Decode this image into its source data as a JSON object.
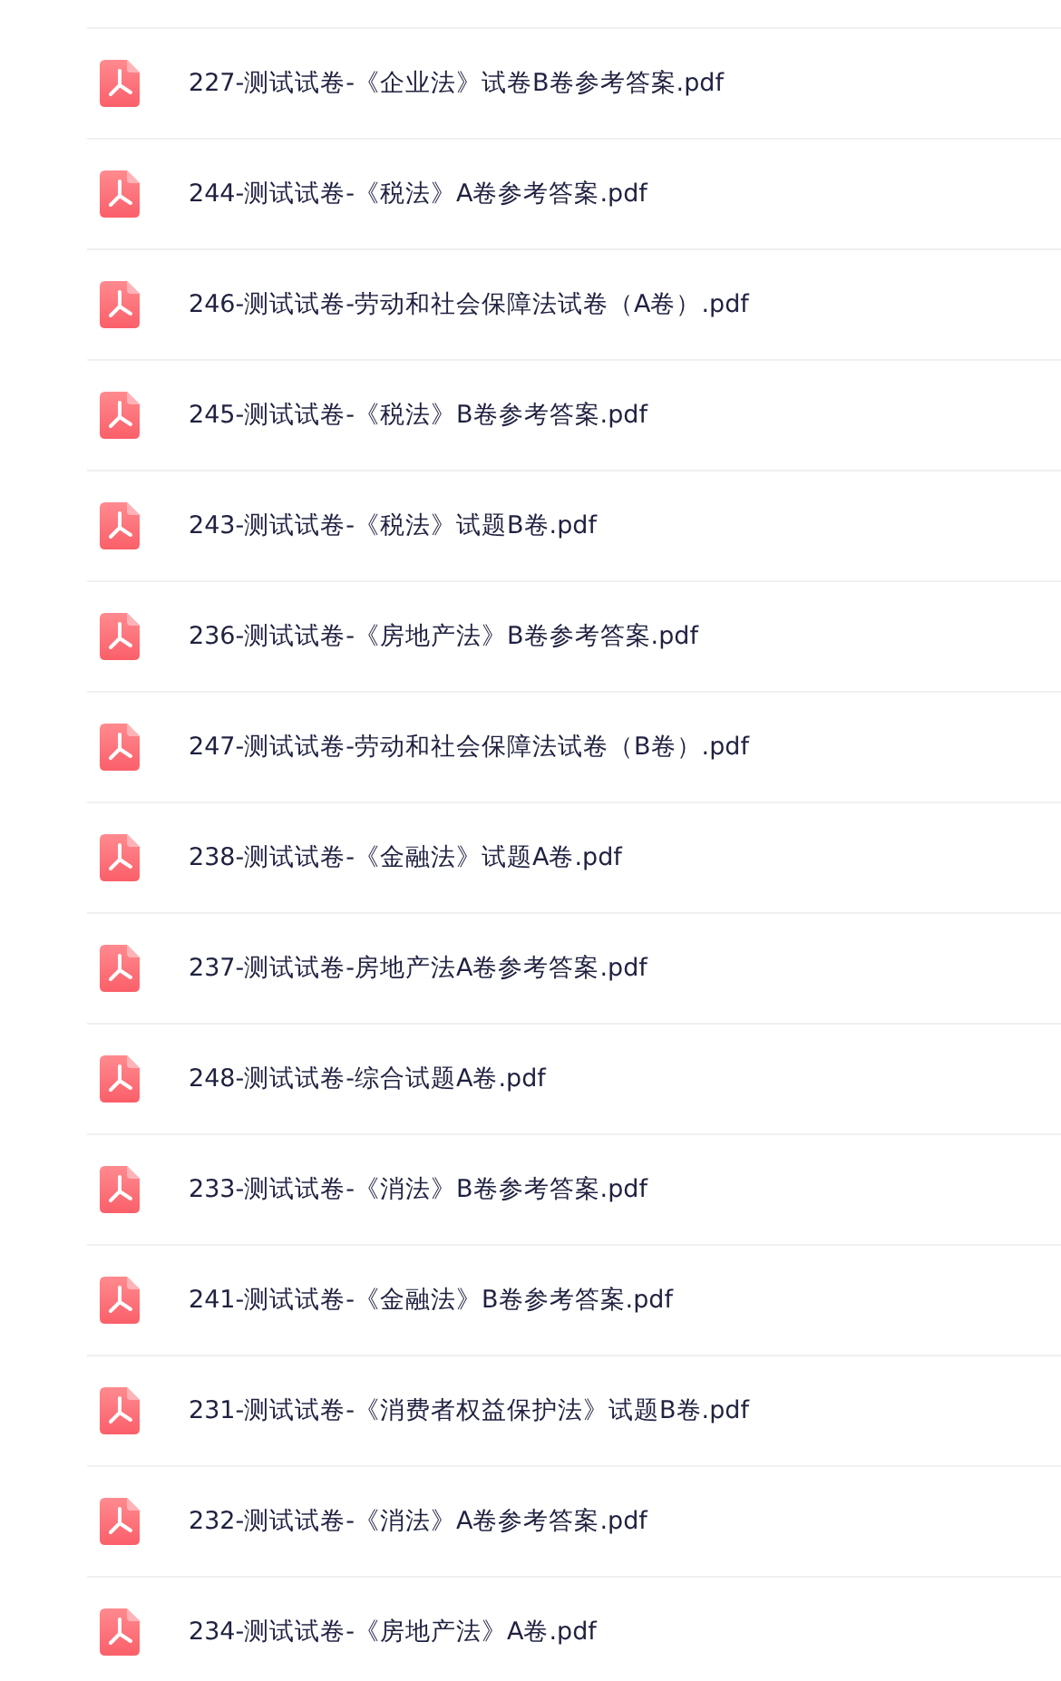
{
  "files": [
    {
      "name": "227-测试试卷-《企业法》试卷B卷参考答案.pdf"
    },
    {
      "name": "244-测试试卷-《税法》A卷参考答案.pdf"
    },
    {
      "name": "246-测试试卷-劳动和社会保障法试卷（A卷）.pdf"
    },
    {
      "name": "245-测试试卷-《税法》B卷参考答案.pdf"
    },
    {
      "name": "243-测试试卷-《税法》试题B卷.pdf"
    },
    {
      "name": "236-测试试卷-《房地产法》B卷参考答案.pdf"
    },
    {
      "name": "247-测试试卷-劳动和社会保障法试卷（B卷）.pdf"
    },
    {
      "name": "238-测试试卷-《金融法》试题A卷.pdf"
    },
    {
      "name": "237-测试试卷-房地产法A卷参考答案.pdf"
    },
    {
      "name": "248-测试试卷-综合试题A卷.pdf"
    },
    {
      "name": "233-测试试卷-《消法》B卷参考答案.pdf"
    },
    {
      "name": "241-测试试卷-《金融法》B卷参考答案.pdf"
    },
    {
      "name": "231-测试试卷-《消费者权益保护法》试题B卷.pdf"
    },
    {
      "name": "232-测试试卷-《消法》A卷参考答案.pdf"
    },
    {
      "name": "234-测试试卷-《房地产法》A卷.pdf"
    }
  ]
}
